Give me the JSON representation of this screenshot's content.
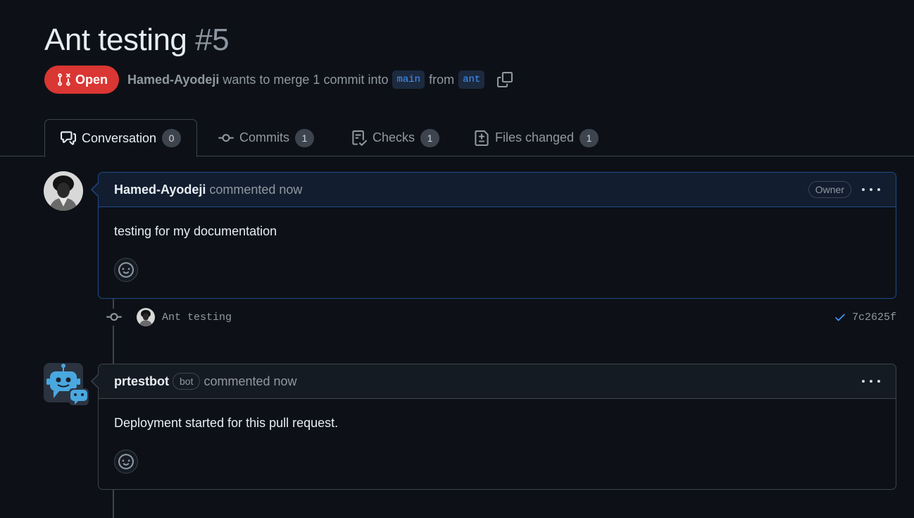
{
  "pr": {
    "title": "Ant testing",
    "number": "#5",
    "state": "Open",
    "author": "Hamed-Ayodeji",
    "merge_text_1": "wants to merge 1 commit into",
    "base_branch": "main",
    "merge_text_2": "from",
    "head_branch": "ant"
  },
  "tabs": [
    {
      "label": "Conversation",
      "count": "0",
      "icon": "comment-discussion-icon"
    },
    {
      "label": "Commits",
      "count": "1",
      "icon": "git-commit-icon"
    },
    {
      "label": "Checks",
      "count": "1",
      "icon": "checklist-icon"
    },
    {
      "label": "Files changed",
      "count": "1",
      "icon": "file-diff-icon"
    }
  ],
  "comments": [
    {
      "login": "Hamed-Ayodeji",
      "action": "commented now",
      "label": "Owner",
      "body": "testing for my documentation"
    },
    {
      "login": "prtestbot",
      "bot_label": "bot",
      "action": "commented now",
      "body": "Deployment started for this pull request."
    }
  ],
  "commit": {
    "message": "Ant testing",
    "sha": "7c2625f",
    "status": "success"
  },
  "colors": {
    "open": "#da3633",
    "accent": "#4493f8",
    "background": "#0d1117"
  }
}
